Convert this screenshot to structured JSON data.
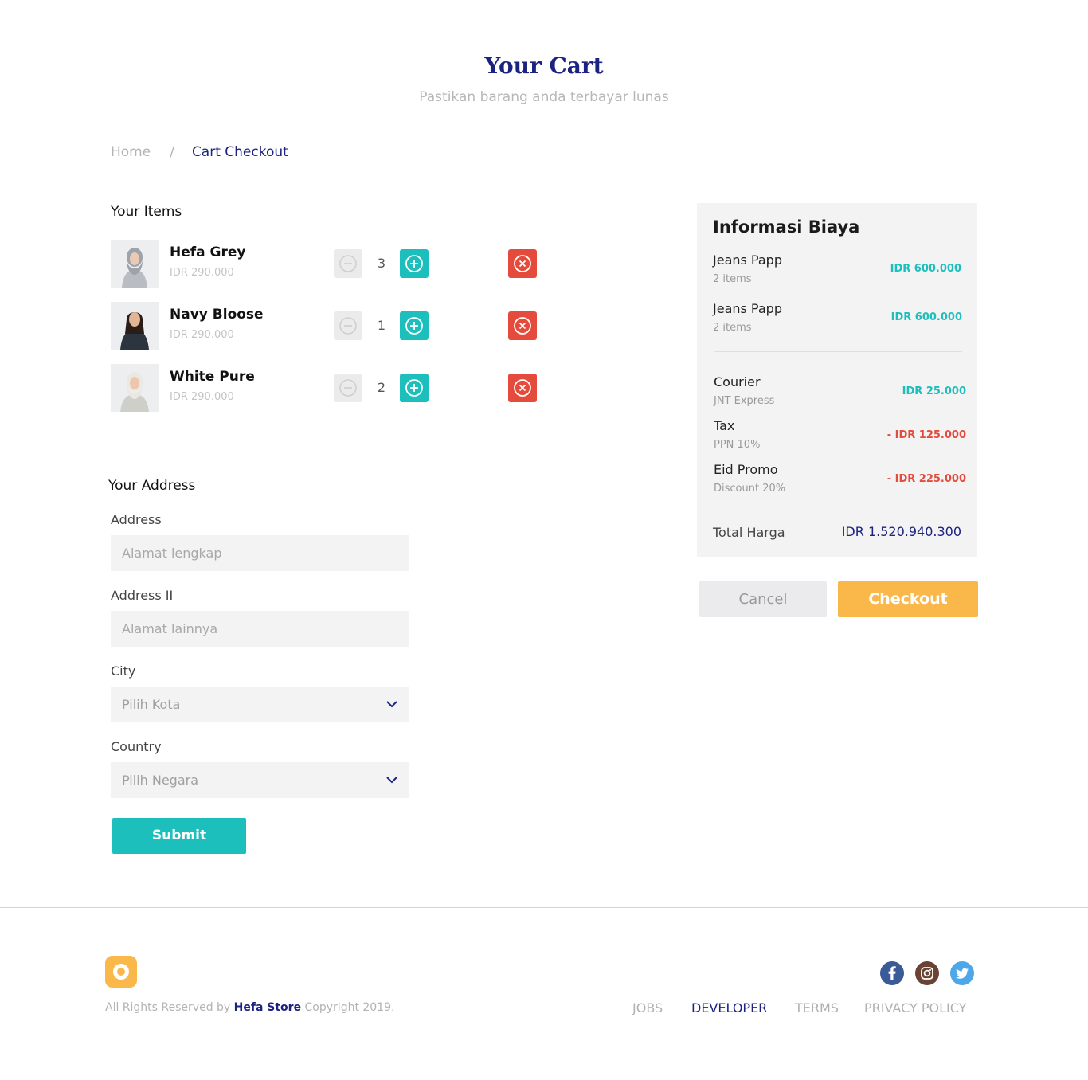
{
  "header": {
    "title": "Your Cart",
    "subtitle": "Pastikan barang anda terbayar lunas"
  },
  "breadcrumb": {
    "home": "Home",
    "separator": "/",
    "current": "Cart Checkout"
  },
  "items_section": {
    "title": "Your Items",
    "items": [
      {
        "name": "Hefa Grey",
        "price": "IDR 290.000",
        "quantity": "3"
      },
      {
        "name": "Navy Bloose",
        "price": "IDR 290.000",
        "quantity": "1"
      },
      {
        "name": "White Pure",
        "price": "IDR 290.000",
        "quantity": "2"
      }
    ]
  },
  "address": {
    "title": "Your Address",
    "address_label": "Address",
    "address_placeholder": "Alamat lengkap",
    "address2_label": "Address II",
    "address2_placeholder": "Alamat lainnya",
    "city_label": "City",
    "city_placeholder": "Pilih Kota",
    "country_label": "Country",
    "country_placeholder": "Pilih Negara",
    "submit_label": "Submit"
  },
  "summary": {
    "title": "Informasi Biaya",
    "lines": [
      {
        "name": "Jeans Papp",
        "sub": "2 items",
        "value": "IDR 600.000"
      },
      {
        "name": "Jeans Papp",
        "sub": "2 items",
        "value": "IDR 600.000"
      }
    ],
    "courier": {
      "name": "Courier",
      "sub": "JNT Express",
      "value": "IDR 25.000"
    },
    "tax": {
      "name": "Tax",
      "sub": "PPN 10%",
      "value": "- IDR 125.000"
    },
    "promo": {
      "name": "Eid Promo",
      "sub": "Discount 20%",
      "value": "- IDR 225.000"
    },
    "total_label": "Total Harga",
    "total_value": "IDR 1.520.940.300"
  },
  "actions": {
    "cancel": "Cancel",
    "checkout": "Checkout"
  },
  "footer": {
    "copyright_prefix": "All Rights Reserved by",
    "brand": "Hefa Store",
    "copyright_suffix": "Copyright 2019.",
    "links": [
      "JOBS",
      "DEVELOPER",
      "TERMS",
      "PRIVACY POLICY"
    ],
    "social_icons": [
      "facebook-icon",
      "instagram-icon",
      "twitter-icon"
    ]
  },
  "colors": {
    "primary_navy": "#1b2280",
    "teal": "#1dbfbd",
    "red": "#e54b3c",
    "orange": "#fbb84a"
  }
}
